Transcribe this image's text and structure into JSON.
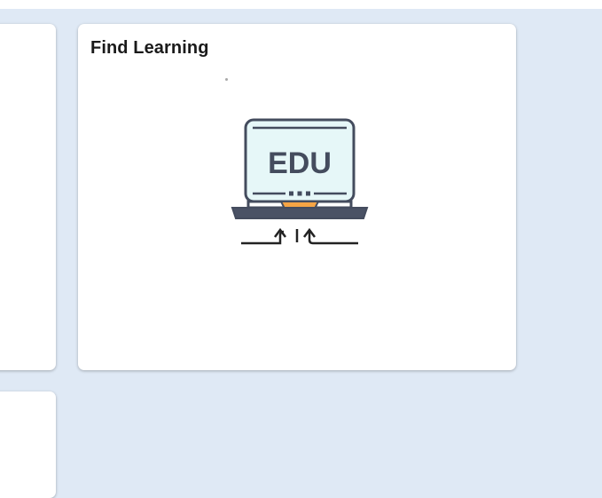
{
  "tiles": {
    "find_learning": {
      "title": "Find Learning",
      "icon": "laptop-edu-icon",
      "icon_text": "EDU"
    }
  },
  "colors": {
    "page_background": "#dfe9f5",
    "tile_background": "#ffffff",
    "icon_screen": "#e6f7f8",
    "icon_frame": "#444c5e",
    "icon_accent": "#f6a444"
  }
}
